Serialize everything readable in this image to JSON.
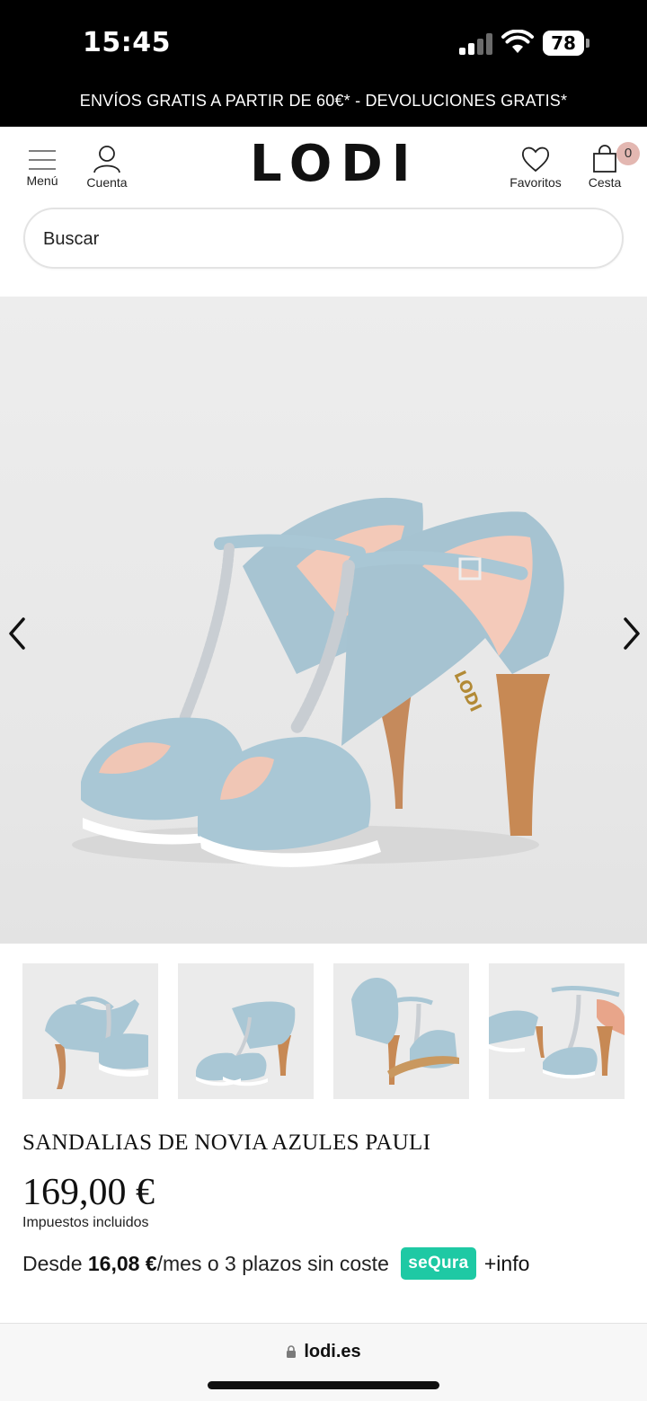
{
  "status_bar": {
    "time": "15:45",
    "battery": "78"
  },
  "promo": {
    "text": "ENVÍOS GRATIS A PARTIR DE 60€* - DEVOLUCIONES GRATIS*"
  },
  "header": {
    "menu_label": "Menú",
    "account_label": "Cuenta",
    "logo": "LODI",
    "favorites_label": "Favoritos",
    "cart_label": "Cesta",
    "cart_count": "0"
  },
  "search": {
    "placeholder": "Buscar"
  },
  "product": {
    "title": "SANDALIAS DE NOVIA AZULES PAULI",
    "price": "169,00 €",
    "tax_note": "Impuestos incluidos",
    "financing": {
      "prefix": "Desde ",
      "amount": "16,08 €",
      "suffix": "/mes o 3 plazos sin coste",
      "provider": "seQura",
      "more": "+info"
    }
  },
  "gallery": {
    "thumbnail_count": 4
  },
  "colors": {
    "accent": "#1ec9a4",
    "badge": "#e3b7b1",
    "shoe": "#a9c7d5"
  },
  "browser": {
    "url": "lodi.es"
  }
}
